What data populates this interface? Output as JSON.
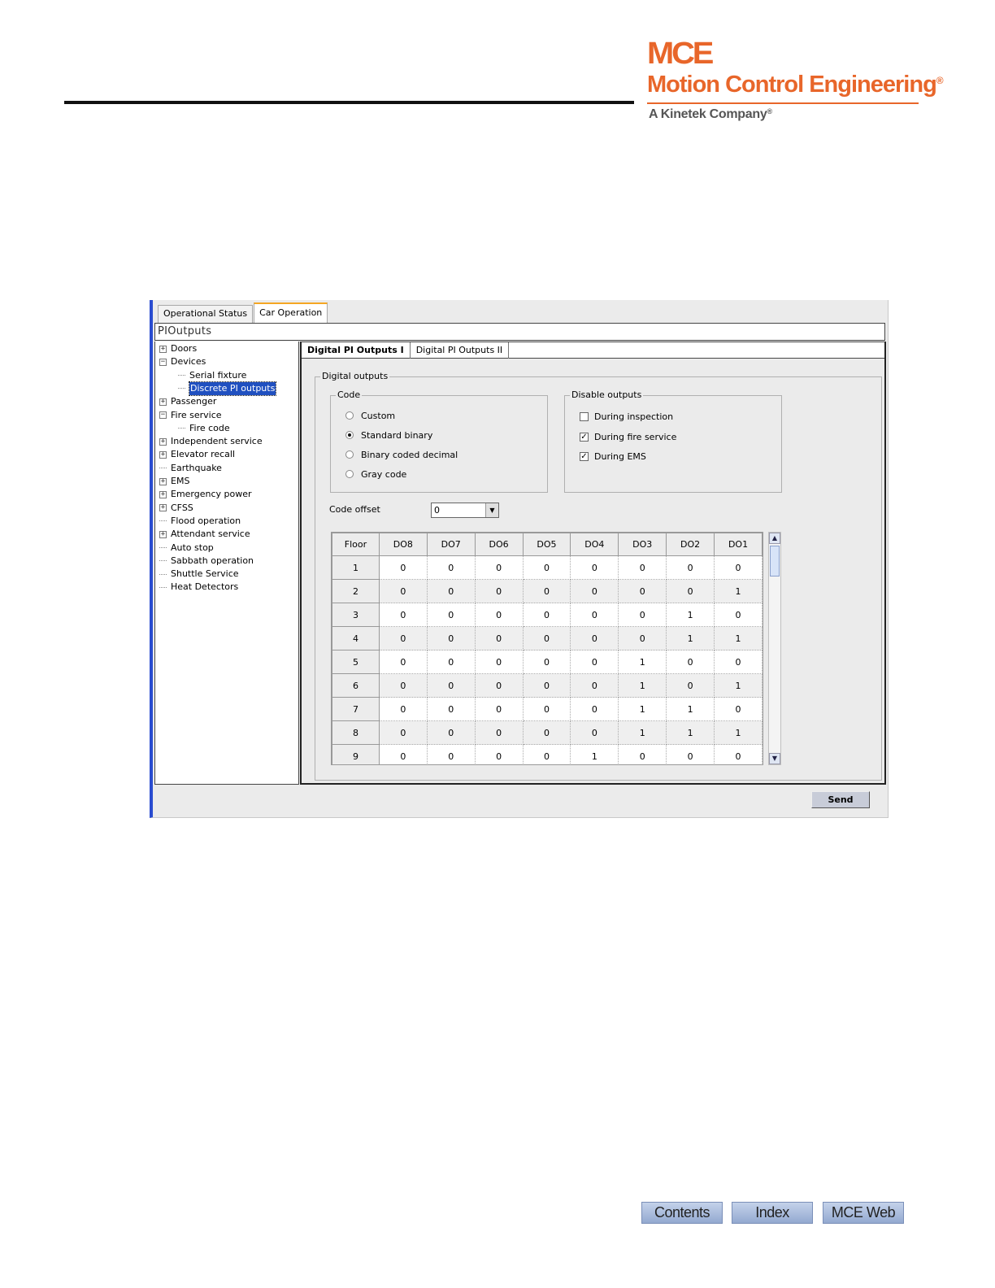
{
  "header": {
    "logo_mark": "MCE",
    "company_name": "Motion Control Engineering",
    "registered_mark": "®",
    "tagline": "A Kinetek Company",
    "accent_color": "#e8662a"
  },
  "window": {
    "top_tabs": [
      "Operational Status",
      "Car Operation"
    ],
    "active_top_tab": "Car Operation",
    "title": "PIOutputs",
    "tree": [
      {
        "label": "Doors",
        "toggle": "+"
      },
      {
        "label": "Devices",
        "toggle": "-"
      },
      {
        "label": "Serial fixture",
        "child": true
      },
      {
        "label": "Discrete PI outputs",
        "child": true,
        "selected": true
      },
      {
        "label": "Passenger",
        "toggle": "+"
      },
      {
        "label": "Fire service",
        "toggle": "-"
      },
      {
        "label": "Fire code",
        "child": true
      },
      {
        "label": "Independent service",
        "toggle": "+"
      },
      {
        "label": "Elevator recall",
        "toggle": "+"
      },
      {
        "label": "Earthquake"
      },
      {
        "label": "EMS",
        "toggle": "+"
      },
      {
        "label": "Emergency power",
        "toggle": "+"
      },
      {
        "label": "CFSS",
        "toggle": "+"
      },
      {
        "label": "Flood operation"
      },
      {
        "label": "Attendant service",
        "toggle": "+"
      },
      {
        "label": "Auto stop"
      },
      {
        "label": "Sabbath operation"
      },
      {
        "label": "Shuttle Service"
      },
      {
        "label": "Heat Detectors"
      }
    ],
    "sub_tabs": [
      "Digital PI Outputs I",
      "Digital PI Outputs II"
    ],
    "digital_outputs_title": "Digital outputs",
    "code_group": {
      "title": "Code",
      "options": [
        "Custom",
        "Standard binary",
        "Binary coded decimal",
        "Gray code"
      ],
      "selected": "Standard binary"
    },
    "disable_group": {
      "title": "Disable outputs",
      "options": [
        {
          "label": "During inspection",
          "checked": false
        },
        {
          "label": "During fire service",
          "checked": true
        },
        {
          "label": "During EMS",
          "checked": true
        }
      ]
    },
    "code_offset_label": "Code offset",
    "code_offset_value": "0",
    "grid": {
      "columns": [
        "Floor",
        "DO8",
        "DO7",
        "DO6",
        "DO5",
        "DO4",
        "DO3",
        "DO2",
        "DO1"
      ],
      "rows": [
        [
          "1",
          "0",
          "0",
          "0",
          "0",
          "0",
          "0",
          "0",
          "0"
        ],
        [
          "2",
          "0",
          "0",
          "0",
          "0",
          "0",
          "0",
          "0",
          "1"
        ],
        [
          "3",
          "0",
          "0",
          "0",
          "0",
          "0",
          "0",
          "1",
          "0"
        ],
        [
          "4",
          "0",
          "0",
          "0",
          "0",
          "0",
          "0",
          "1",
          "1"
        ],
        [
          "5",
          "0",
          "0",
          "0",
          "0",
          "0",
          "1",
          "0",
          "0"
        ],
        [
          "6",
          "0",
          "0",
          "0",
          "0",
          "0",
          "1",
          "0",
          "1"
        ],
        [
          "7",
          "0",
          "0",
          "0",
          "0",
          "0",
          "1",
          "1",
          "0"
        ],
        [
          "8",
          "0",
          "0",
          "0",
          "0",
          "0",
          "1",
          "1",
          "1"
        ],
        [
          "9",
          "0",
          "0",
          "0",
          "0",
          "1",
          "0",
          "0",
          "0"
        ]
      ]
    },
    "send_label": "Send",
    "border_accent_color": "#2a4cd0",
    "tab_accent_color": "#f5a623"
  },
  "footer_nav": [
    "Contents",
    "Index",
    "MCE Web"
  ]
}
